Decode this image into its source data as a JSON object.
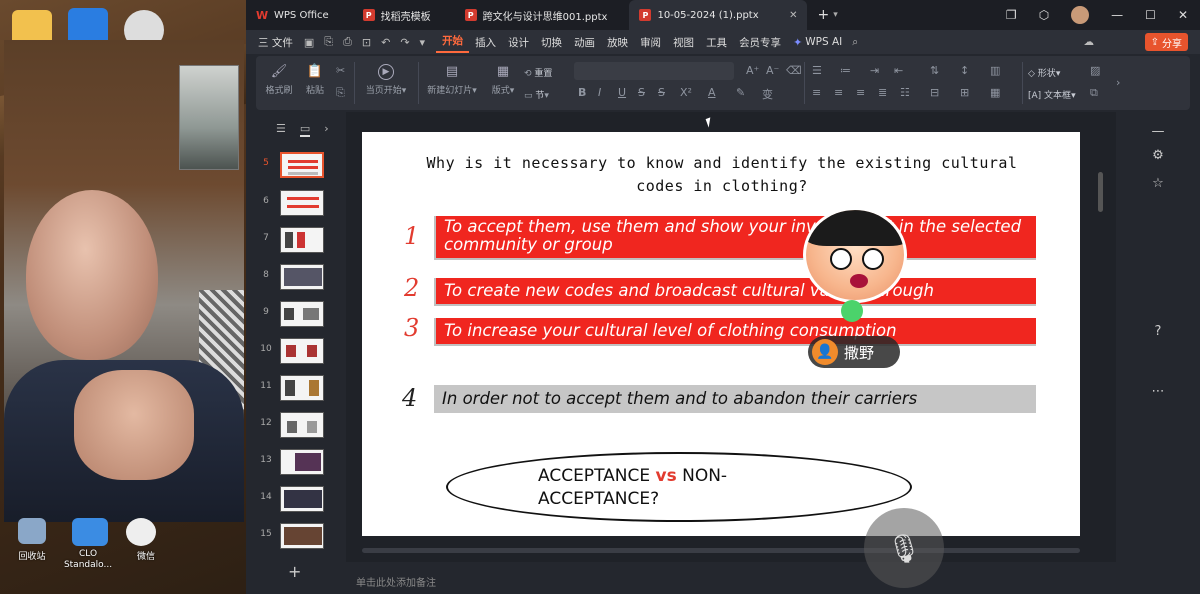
{
  "desktop": {
    "icons": [
      {
        "label": "回收站",
        "name": "recycle-bin"
      },
      {
        "label": "CLO Standalo...",
        "name": "clo-standalone"
      },
      {
        "label": "微信",
        "name": "wechat"
      }
    ]
  },
  "tabs": [
    {
      "label": "WPS Office",
      "icon": "W"
    },
    {
      "label": "找稻壳模板",
      "icon": "P"
    },
    {
      "label": "跨文化与设计思维001.pptx",
      "icon": "P"
    },
    {
      "label": "10-05-2024 (1).pptx",
      "icon": "P"
    }
  ],
  "menu": {
    "file": "三 文件",
    "items": [
      "开始",
      "插入",
      "设计",
      "切换",
      "动画",
      "放映",
      "审阅",
      "视图",
      "工具",
      "会员专享"
    ],
    "active": "开始",
    "wps_ai": "WPS AI",
    "share": "分享"
  },
  "ribbon": {
    "format_painter": "格式刷",
    "paste": "粘贴",
    "start_from_current": "当页开始",
    "new_slide": "新建幻灯片",
    "layout": "版式",
    "section": "节",
    "reset": "重置",
    "shape": "形状",
    "textbox": "文本框"
  },
  "slides_panel": {
    "numbers": [
      "5",
      "6",
      "7",
      "8",
      "9",
      "10",
      "11",
      "12",
      "13",
      "14",
      "15"
    ],
    "selected": "5",
    "add": "+"
  },
  "slide": {
    "title_line1": "Why is it necessary to know and identify the existing cultural",
    "title_line2": "codes in clothing?",
    "items": [
      {
        "num": "1",
        "text": "To accept them, use them and show your involvement in the selected community or group"
      },
      {
        "num": "2",
        "text": "To create new codes and broadcast cultural values through"
      },
      {
        "num": "3",
        "text": "To increase your cultural level of clothing consumption"
      },
      {
        "num": "4",
        "text": "In order not to accept them and to abandon their carriers"
      }
    ],
    "ellipse_part1": "ACCEPTANCE ",
    "ellipse_vs": "vs",
    "ellipse_part2": " NON-ACCEPTANCE?"
  },
  "notes_placeholder": "单击此处添加备注",
  "call": {
    "user_name": "撒野"
  },
  "colors": {
    "accent": "#e8542d",
    "slide_red": "#f0261f",
    "slide_gray": "#c6c6c6"
  }
}
